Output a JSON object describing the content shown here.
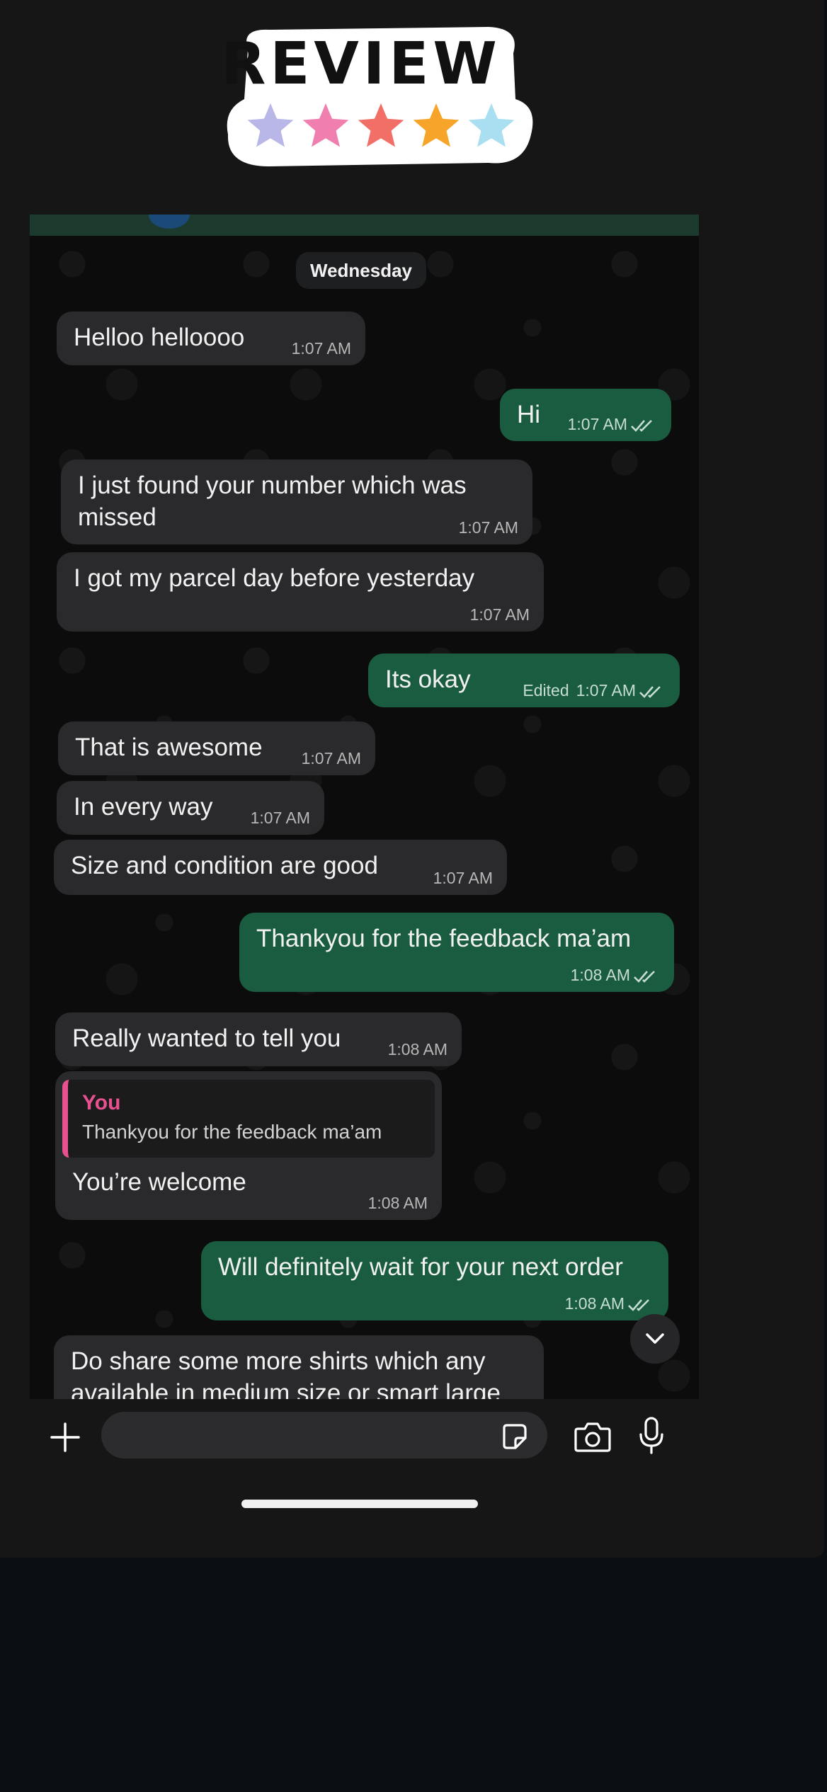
{
  "sticker": {
    "text": "REVIEW",
    "star_colors": [
      "#b9b6e8",
      "#f07fb0",
      "#f26f67",
      "#f7a52a",
      "#a9dff0"
    ]
  },
  "chat": {
    "date_chip": "Wednesday",
    "messages": [
      {
        "dir": "in",
        "text": "Helloo helloooo",
        "time": "1:07 AM"
      },
      {
        "dir": "out",
        "text": "Hi",
        "time": "1:07 AM",
        "status": "read-double-tick"
      },
      {
        "dir": "in",
        "text": "I just found your number which was missed",
        "time": "1:07 AM"
      },
      {
        "dir": "in",
        "text": "I got my parcel day before yesterday",
        "time": "1:07 AM"
      },
      {
        "dir": "out",
        "text": "Its okay",
        "edited": "Edited",
        "time": "1:07 AM",
        "status": "read-double-tick"
      },
      {
        "dir": "in",
        "text": "That is awesome",
        "time": "1:07 AM"
      },
      {
        "dir": "in",
        "text": "In every way",
        "time": "1:07 AM"
      },
      {
        "dir": "in",
        "text": "Size and condition are good",
        "time": "1:07 AM"
      },
      {
        "dir": "out",
        "text": "Thankyou for the feedback ma’am",
        "time": "1:08 AM",
        "status": "read-double-tick"
      },
      {
        "dir": "in",
        "text": "Really wanted to tell you",
        "time": "1:08 AM"
      },
      {
        "dir": "in",
        "quote_author": "You",
        "quote_text": "Thankyou for the feedback ma’am",
        "text": "You’re welcome",
        "time": "1:08 AM"
      },
      {
        "dir": "out",
        "text": "Will definitely wait for your next order",
        "time": "1:08 AM",
        "status": "read-double-tick"
      },
      {
        "dir": "in",
        "text": "Do share some more shirts which any available in medium size or smart large"
      }
    ]
  },
  "composer": {
    "icons": [
      "plus-icon",
      "sticker-icon",
      "camera-icon",
      "microphone-icon"
    ]
  },
  "colors": {
    "incoming_bubble": "#2a2a2c",
    "outgoing_bubble": "#1a5c40",
    "quote_accent": "#e8518f"
  }
}
